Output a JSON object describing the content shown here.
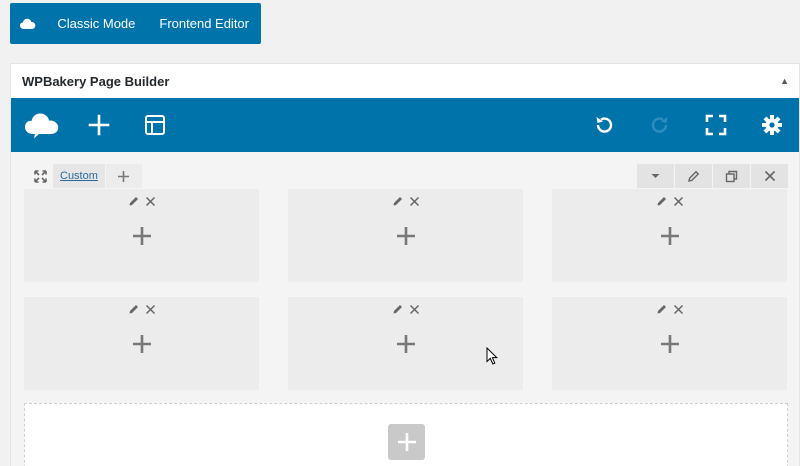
{
  "mode_bar": {
    "classic_label": "Classic Mode",
    "frontend_label": "Frontend Editor"
  },
  "panel": {
    "title": "WPBakery Page Builder"
  },
  "row": {
    "layout_label": "Custom"
  },
  "colors": {
    "accent": "#0073aa",
    "column_bg": "#ececec",
    "canvas_bg": "#f4f4f4"
  },
  "icons": {
    "logo": "wpbakery-cloud-icon",
    "add": "plus-icon",
    "templates": "layout-template-icon",
    "undo": "undo-icon",
    "redo": "redo-icon",
    "fullscreen": "fullscreen-icon",
    "settings": "gear-icon"
  }
}
